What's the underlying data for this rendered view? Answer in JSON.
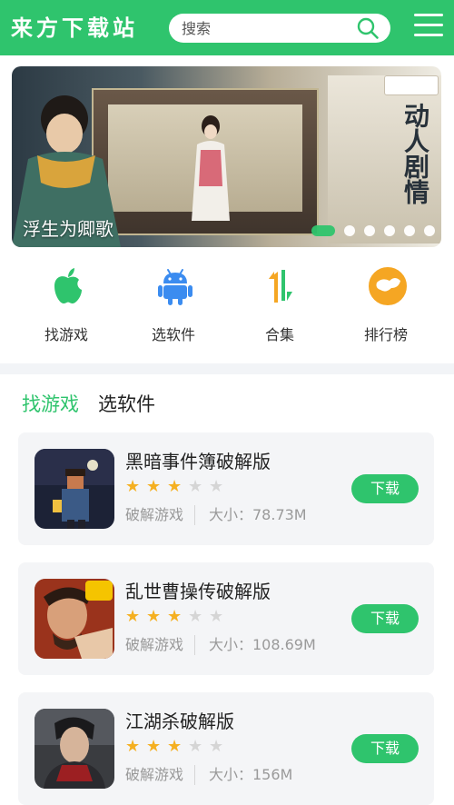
{
  "header": {
    "logo_text": "来方下载站",
    "search_placeholder": "搜索",
    "search_icon": "search-icon",
    "menu_icon": "hamburger-menu-icon",
    "brand_color": "#2fc46d"
  },
  "banner": {
    "title": "浮生为卿歌",
    "slogan": "动人剧情",
    "slide_count": 6,
    "active_slide": 1
  },
  "quick_entries": [
    {
      "label": "找游戏",
      "icon": "apple-icon",
      "color": "#2fc46d"
    },
    {
      "label": "选软件",
      "icon": "android-icon",
      "color": "#3b8cf0"
    },
    {
      "label": "合集",
      "icon": "collection-icon",
      "color": "#f5a623"
    },
    {
      "label": "排行榜",
      "icon": "ranking-icon",
      "color": "#f5a623"
    }
  ],
  "tabs": [
    {
      "label": "找游戏",
      "active": true
    },
    {
      "label": "选软件",
      "active": false
    }
  ],
  "games": [
    {
      "name": "黑暗事件簿破解版",
      "rating": 3,
      "max_rating": 5,
      "category": "破解游戏",
      "size": "大小：78.73M",
      "button": "下载"
    },
    {
      "name": "乱世曹操传破解版",
      "rating": 3,
      "max_rating": 5,
      "category": "破解游戏",
      "size": "大小：108.69M",
      "button": "下载"
    },
    {
      "name": "江湖杀破解版",
      "rating": 3,
      "max_rating": 5,
      "category": "破解游戏",
      "size": "大小：156M",
      "button": "下载"
    }
  ]
}
